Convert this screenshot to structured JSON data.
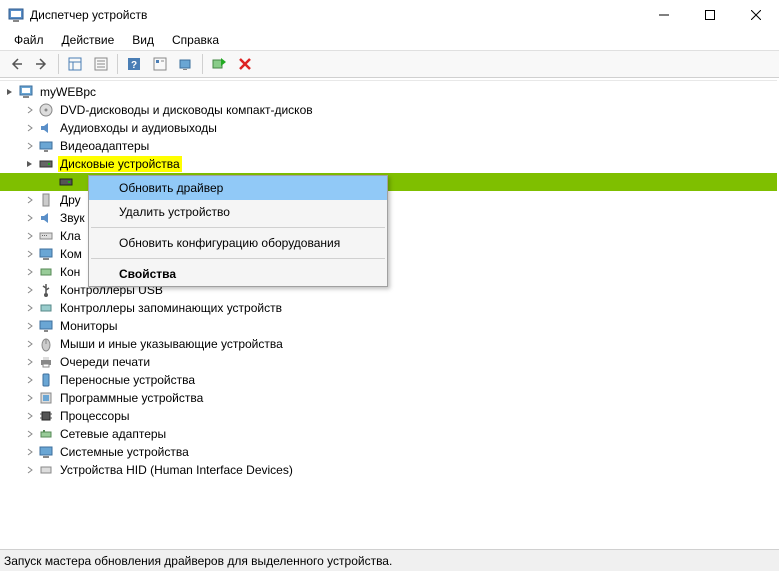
{
  "window": {
    "title": "Диспетчер устройств"
  },
  "menubar": {
    "file": "Файл",
    "action": "Действие",
    "view": "Вид",
    "help": "Справка"
  },
  "tree": {
    "root": "myWEBpc",
    "items": [
      "DVD-дисководы и дисководы компакт-дисков",
      "Аудиовходы и аудиовыходы",
      "Видеоадаптеры",
      "Дисковые устройства",
      "Дру",
      "Звук",
      "Кла",
      "Ком",
      "Кон",
      "Контроллеры USB",
      "Контроллеры запоминающих устройств",
      "Мониторы",
      "Мыши и иные указывающие устройства",
      "Очереди печати",
      "Переносные устройства",
      "Программные устройства",
      "Процессоры",
      "Сетевые адаптеры",
      "Системные устройства",
      "Устройства HID (Human Interface Devices)"
    ]
  },
  "context_menu": {
    "update_driver": "Обновить драйвер",
    "uninstall": "Удалить устройство",
    "scan_hardware": "Обновить конфигурацию оборудования",
    "properties": "Свойства"
  },
  "statusbar": {
    "text": "Запуск мастера обновления драйверов для выделенного устройства."
  }
}
